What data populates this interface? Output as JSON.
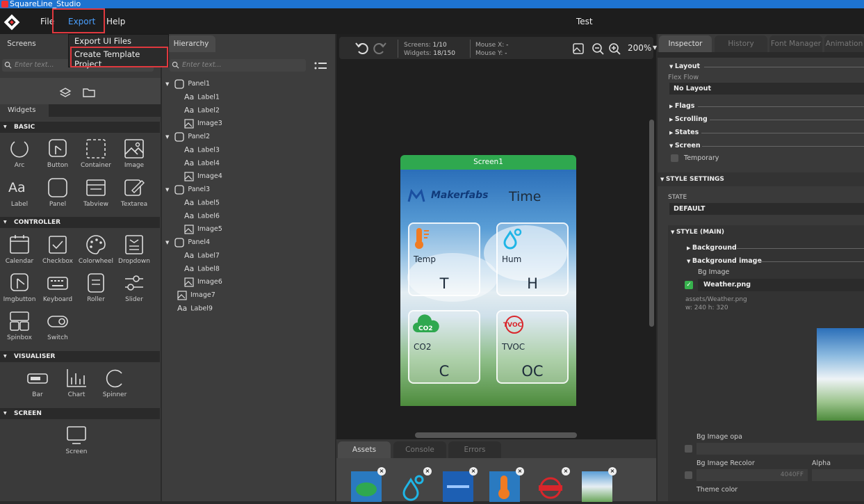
{
  "titlebar": {
    "title": "SquareLine_Studio"
  },
  "menubar": {
    "file": "File",
    "export": "Export",
    "help": "Help",
    "project_name": "Test"
  },
  "export_menu": {
    "item1": "Export UI Files",
    "item2": "Create Template Project"
  },
  "left": {
    "tabs": {
      "screens": "Screens",
      "hierarchy": "Hierarchy"
    },
    "search_placeholder": "Enter text...",
    "widgets_tab": "Widgets",
    "categories": {
      "basic": "BASIC",
      "controller": "CONTROLLER",
      "visualiser": "VISUALISER",
      "screen": "SCREEN"
    },
    "basic": [
      "Arc",
      "Button",
      "Container",
      "Image",
      "Label",
      "Panel",
      "Tabview",
      "Textarea"
    ],
    "controller": [
      "Calendar",
      "Checkbox",
      "Colorwheel",
      "Dropdown",
      "Imgbutton",
      "Keyboard",
      "Roller",
      "Slider",
      "Spinbox",
      "Switch"
    ],
    "visualiser": [
      "Bar",
      "Chart",
      "Spinner"
    ],
    "screen": [
      "Screen"
    ]
  },
  "hierarchy": {
    "search_placeholder": "Enter text...",
    "items": [
      "Panel1",
      "Label1",
      "Label2",
      "Image3",
      "Panel2",
      "Label3",
      "Label4",
      "Image4",
      "Panel3",
      "Label5",
      "Label6",
      "Image5",
      "Panel4",
      "Label7",
      "Label8",
      "Image6",
      "Image7",
      "Label9"
    ]
  },
  "canvas": {
    "screens_label": "Screens:",
    "screens_value": "1/10",
    "widgets_label": "Widgets:",
    "widgets_value": "18/150",
    "mousex_label": "Mouse X:",
    "mousex_value": "-",
    "mousey_label": "Mouse Y:",
    "mousey_value": "-",
    "zoom": "200%",
    "screen_title": "Screen1",
    "brand": "Makerfabs",
    "time": "Time",
    "cards": [
      {
        "label": "Temp",
        "value": "T"
      },
      {
        "label": "Hum",
        "value": "H"
      },
      {
        "label": "CO2",
        "value": "C",
        "badge": "CO2"
      },
      {
        "label": "TVOC",
        "value": "OC",
        "badge": "TVOC"
      }
    ]
  },
  "bottom_tabs": {
    "assets": "Assets",
    "console": "Console",
    "errors": "Errors"
  },
  "inspector": {
    "tabs": {
      "inspector": "Inspector",
      "history": "History",
      "font_manager": "Font Manager",
      "animation": "Animation"
    },
    "layout": "Layout",
    "flex_flow": "Flex Flow",
    "flex_flow_value": "No Layout",
    "flags": "Flags",
    "scrolling": "Scrolling",
    "states": "States",
    "screen": "Screen",
    "temporary": "Temporary",
    "style_settings": "STYLE SETTINGS",
    "state": "STATE",
    "state_value": "DEFAULT",
    "style_main": "STYLE (MAIN)",
    "background": "Background",
    "background_image": "Background image",
    "bg_image": "Bg Image",
    "bg_image_value": "Weather.png",
    "bg_path": "assets/Weather.png",
    "bg_size": "w: 240  h: 320",
    "bg_opa": "Bg Image opa",
    "bg_recolor": "Bg Image Recolor",
    "alpha": "Alpha",
    "recolor_value": "4040FF",
    "theme_color": "Theme color"
  },
  "colors": {
    "accent": "#4aa0ff",
    "screen_header": "#2fa84f",
    "highlight": "#e0383e"
  }
}
